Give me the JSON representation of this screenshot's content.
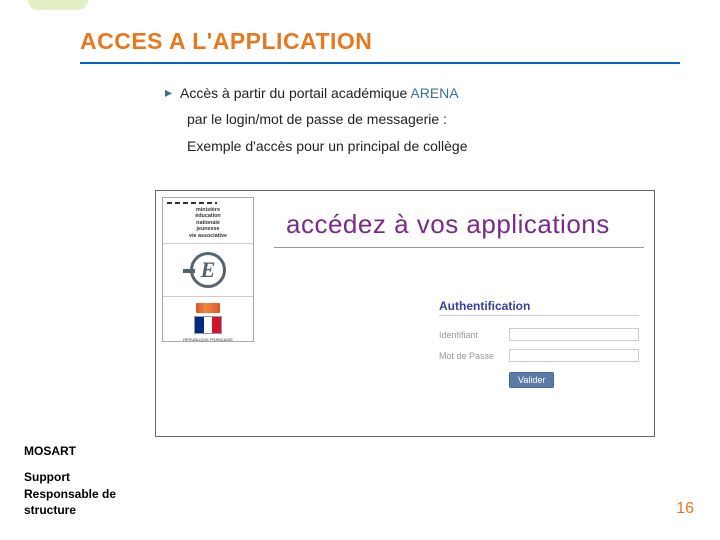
{
  "slide": {
    "title": "ACCES A  L'APPLICATION",
    "bullet1_prefix": "Accès à partir du portail académique ",
    "bullet1_arena": "ARENA",
    "bullet_line2": "par le login/mot de passe de messagerie :",
    "bullet_line3": "Exemple d'accès pour un principal de collège"
  },
  "screenshot": {
    "ministry_lines": "ministère\néducation\nnationale\njeunesse\nvie associative",
    "e_letter": "E",
    "rf": "RÉPUBLIQUE FRANÇAISE",
    "banner": "accédez à vos applications",
    "auth": {
      "title": "Authentification",
      "identifiant": "Identifiant",
      "motdepasse": "Mot de Passe",
      "valider": "Valider"
    }
  },
  "footer": {
    "mosart": "MOSART",
    "support": "Support\nResponsable de\nstructure",
    "page": "16"
  }
}
